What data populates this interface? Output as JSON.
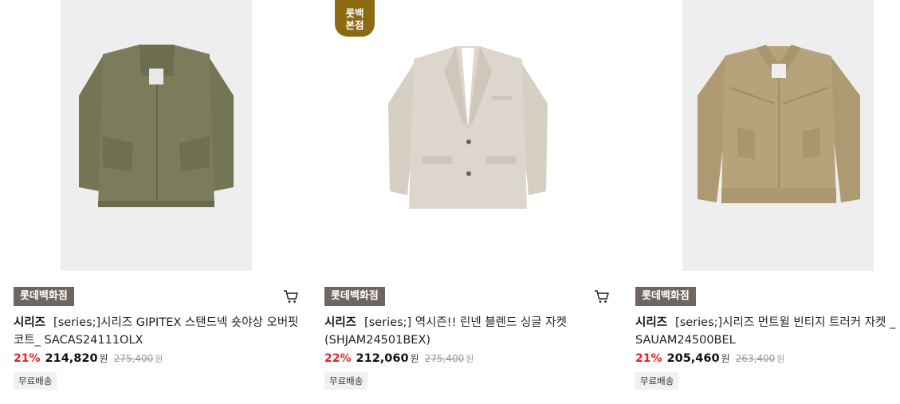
{
  "products": [
    {
      "store_tag": "롯데백화점",
      "brand": "시리즈",
      "name": "[series;]시리즈 GIPITEX 스탠드넥 숏야상 오버핏 코트_ SACAS24111OLX",
      "discount_rate": "21%",
      "sale_price": "214,820",
      "sale_unit": "원",
      "original_price": "275,400",
      "original_unit": "원",
      "shipping": "무료배송",
      "has_cart": true,
      "image_color": "#7b7c5c"
    },
    {
      "lotte_badge": [
        "롯백",
        "본점"
      ],
      "store_tag": "롯데백화점",
      "brand": "시리즈",
      "name": "[series;] 역시즌!! 린넨 블렌드 싱글 자켓 (SHJAM24501BEX)",
      "discount_rate": "22%",
      "sale_price": "212,060",
      "sale_unit": "원",
      "original_price": "275,400",
      "original_unit": "원",
      "shipping": "무료배송",
      "has_cart": true,
      "image_color": "#ddd6cc"
    },
    {
      "store_tag": "롯데백화점",
      "brand": "시리즈",
      "name": "[series;]시리즈 먼트윌 빈티지 트러커 자켓 _ SAUAM24500BEL",
      "discount_rate": "21%",
      "sale_price": "205,460",
      "sale_unit": "원",
      "original_price": "263,400",
      "original_unit": "원",
      "shipping": "무료배송",
      "has_cart": false,
      "image_color": "#b6a37b"
    }
  ],
  "colors": {
    "discount": "#e0252b",
    "store_tag_bg": "#6f6660",
    "lotte_badge_bg": "#8a6a12"
  }
}
